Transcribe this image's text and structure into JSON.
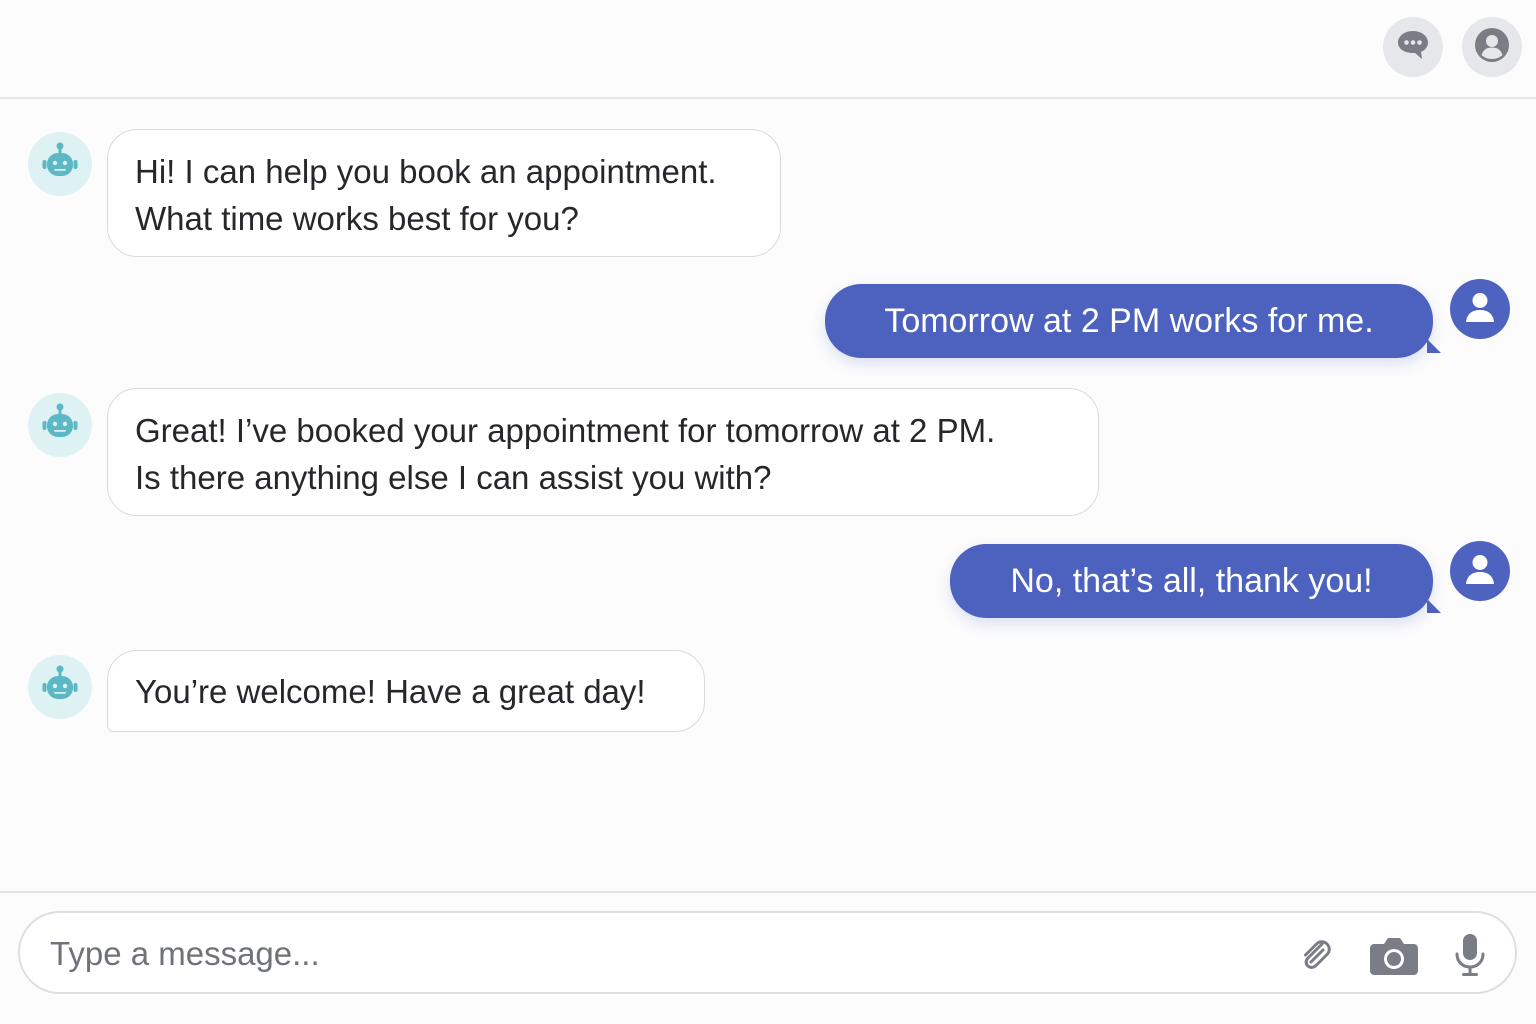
{
  "header": {
    "chat_icon": "chat-bubble-icon",
    "profile_icon": "user-profile-icon"
  },
  "colors": {
    "user_bubble": "#4d62be",
    "bot_avatar_bg": "#dff2f3",
    "bot_icon": "#5bb8c4",
    "header_icon": "#7b7d86"
  },
  "messages": [
    {
      "sender": "bot",
      "lines": [
        "Hi! I can help you book an appointment.",
        "What time works best for you?"
      ]
    },
    {
      "sender": "user",
      "text": "Tomorrow at 2 PM works for me."
    },
    {
      "sender": "bot",
      "lines": [
        "Great! I’ve booked your appointment for tomorrow at 2 PM.",
        "Is there anything else I can assist you with?"
      ]
    },
    {
      "sender": "user",
      "text": "No, that’s all, thank you!"
    },
    {
      "sender": "bot",
      "lines": [
        "You’re welcome! Have a great day!"
      ]
    }
  ],
  "composer": {
    "placeholder": "Type a message...",
    "value": "",
    "attach_icon": "paperclip-icon",
    "camera_icon": "camera-icon",
    "mic_icon": "microphone-icon"
  }
}
